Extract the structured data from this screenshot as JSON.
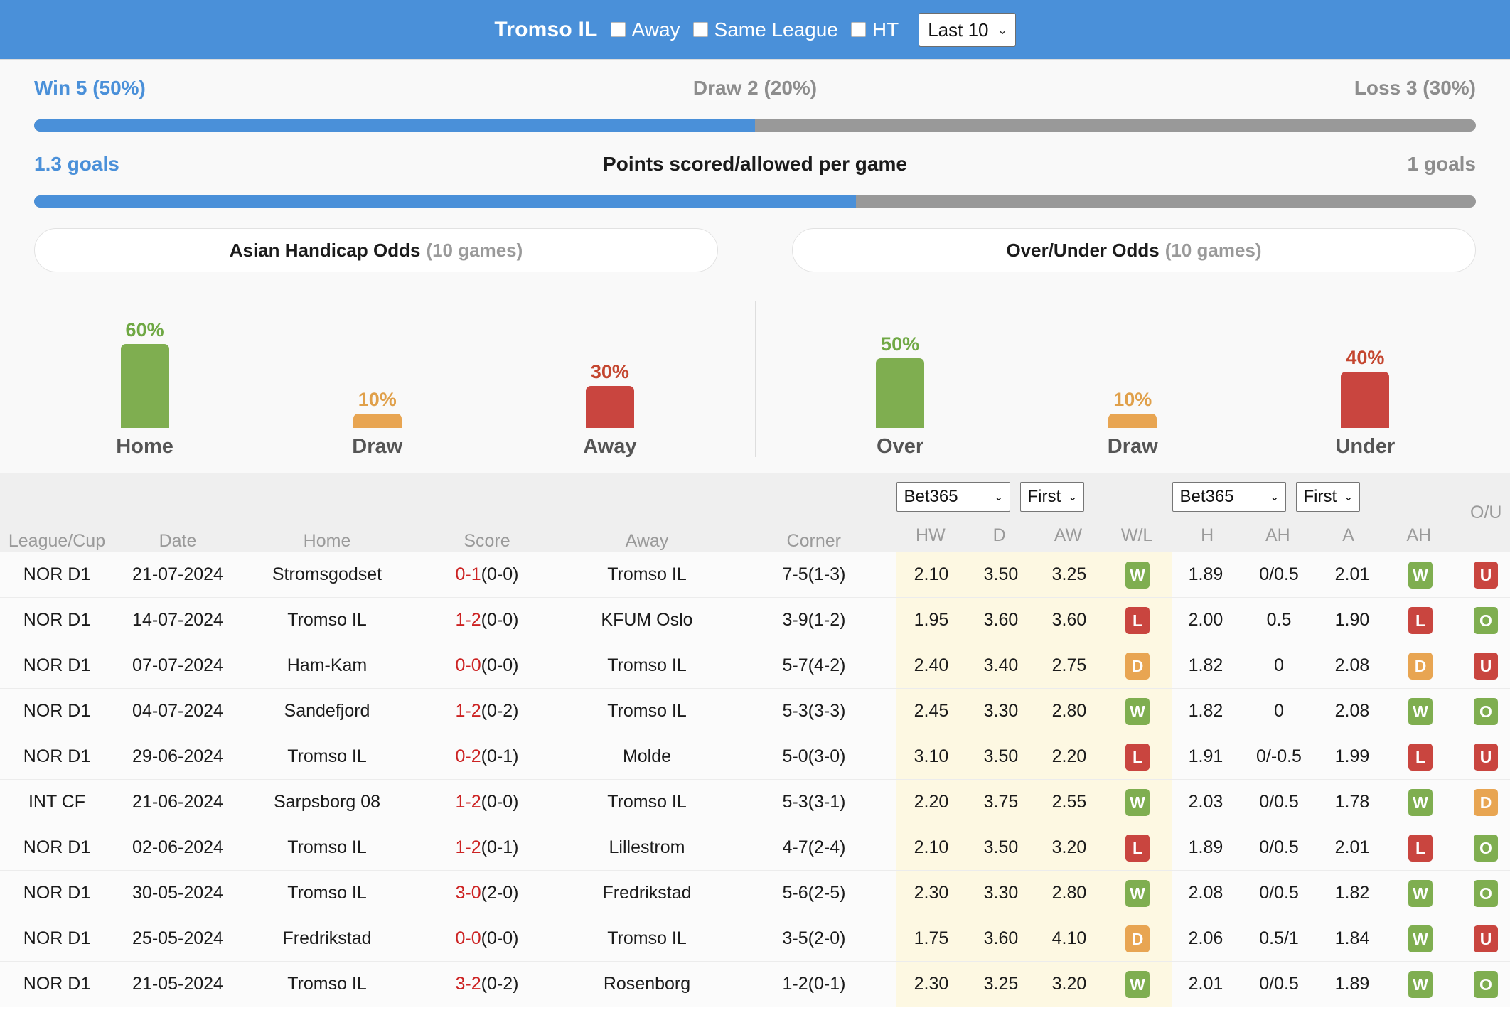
{
  "header": {
    "team": "Tromso IL",
    "filters": [
      {
        "label": "Away",
        "checked": false
      },
      {
        "label": "Same League",
        "checked": false
      },
      {
        "label": "HT",
        "checked": false
      }
    ],
    "range_select": "Last 10",
    "caret": "⌄"
  },
  "summary": {
    "win": "Win 5 (50%)",
    "draw": "Draw 2 (20%)",
    "loss": "Loss 3 (30%)",
    "goals_for": "1.3 goals",
    "points_title": "Points scored/allowed per game",
    "goals_against": "1 goals"
  },
  "pills": {
    "asian": {
      "title": "Asian Handicap Odds",
      "games": "(10 games)"
    },
    "overunder": {
      "title": "Over/Under Odds",
      "games": "(10 games)"
    }
  },
  "colors": {
    "blue": "#4a90d9",
    "grey": "#999999",
    "green": "#7fae50",
    "orange": "#e8a552",
    "red": "#c9453f"
  },
  "chart_data": [
    {
      "type": "bar",
      "title": "Asian Handicap Odds (10 games)",
      "categories": [
        "Home",
        "Draw",
        "Away"
      ],
      "values": [
        60,
        10,
        30
      ],
      "labels": [
        "60%",
        "10%",
        "30%"
      ],
      "colors": [
        "#7fae50",
        "#e8a552",
        "#c9453f"
      ],
      "ylabel": "",
      "xlabel": "",
      "ylim": [
        0,
        100
      ],
      "grid": false,
      "legend": "none"
    },
    {
      "type": "bar",
      "title": "Over/Under Odds (10 games)",
      "categories": [
        "Over",
        "Draw",
        "Under"
      ],
      "values": [
        50,
        10,
        40
      ],
      "labels": [
        "50%",
        "10%",
        "40%"
      ],
      "colors": [
        "#7fae50",
        "#e8a552",
        "#c9453f"
      ],
      "ylabel": "",
      "xlabel": "",
      "ylim": [
        0,
        100
      ],
      "grid": false,
      "legend": "none"
    },
    {
      "type": "bar",
      "title": "Win/Draw/Loss distribution",
      "categories": [
        "Win",
        "Draw",
        "Loss"
      ],
      "values": [
        50,
        20,
        30
      ],
      "labels": [
        "Win 5 (50%)",
        "Draw 2 (20%)",
        "Loss 3 (30%)"
      ],
      "ylabel": "",
      "xlabel": "",
      "ylim": [
        0,
        100
      ],
      "grid": false,
      "legend": "none"
    },
    {
      "type": "bar",
      "title": "Points scored/allowed per game",
      "categories": [
        "Scored",
        "Allowed"
      ],
      "values": [
        1.3,
        1.0
      ],
      "labels": [
        "1.3 goals",
        "1 goals"
      ],
      "ylabel": "",
      "xlabel": "",
      "ylim": [
        0,
        2.3
      ],
      "grid": false,
      "legend": "none"
    }
  ],
  "table": {
    "headers": {
      "league": "League/Cup",
      "date": "Date",
      "home": "Home",
      "score": "Score",
      "away": "Away",
      "corner": "Corner",
      "ou": "O/U"
    },
    "group1": {
      "bookmaker": "Bet365",
      "period": "First",
      "subs": [
        "HW",
        "D",
        "AW",
        "W/L"
      ]
    },
    "group2": {
      "bookmaker": "Bet365",
      "period": "First",
      "subs": [
        "H",
        "AH",
        "A",
        "AH"
      ]
    },
    "rows": [
      {
        "league": "NOR D1",
        "date": "21-07-2024",
        "home": "Stromsgodset",
        "home_link": false,
        "score": "0-1",
        "ht": "(0-0)",
        "away": "Tromso IL",
        "away_link": true,
        "corner": "7-5(1-3)",
        "hw": "2.10",
        "d": "3.50",
        "aw": "3.25",
        "wl": "W",
        "h": "1.89",
        "ah1": "0/0.5",
        "a": "2.01",
        "ah2": "W",
        "ou": "U"
      },
      {
        "league": "NOR D1",
        "date": "14-07-2024",
        "home": "Tromso IL",
        "home_link": true,
        "score": "1-2",
        "ht": "(0-0)",
        "away": "KFUM Oslo",
        "away_link": false,
        "corner": "3-9(1-2)",
        "hw": "1.95",
        "d": "3.60",
        "aw": "3.60",
        "wl": "L",
        "h": "2.00",
        "ah1": "0.5",
        "a": "1.90",
        "ah2": "L",
        "ou": "O"
      },
      {
        "league": "NOR D1",
        "date": "07-07-2024",
        "home": "Ham-Kam",
        "home_link": false,
        "score": "0-0",
        "ht": "(0-0)",
        "away": "Tromso IL",
        "away_link": true,
        "corner": "5-7(4-2)",
        "hw": "2.40",
        "d": "3.40",
        "aw": "2.75",
        "wl": "D",
        "h": "1.82",
        "ah1": "0",
        "a": "2.08",
        "ah2": "D",
        "ou": "U"
      },
      {
        "league": "NOR D1",
        "date": "04-07-2024",
        "home": "Sandefjord",
        "home_link": false,
        "score": "1-2",
        "ht": "(0-2)",
        "away": "Tromso IL",
        "away_link": true,
        "corner": "5-3(3-3)",
        "hw": "2.45",
        "d": "3.30",
        "aw": "2.80",
        "wl": "W",
        "h": "1.82",
        "ah1": "0",
        "a": "2.08",
        "ah2": "W",
        "ou": "O"
      },
      {
        "league": "NOR D1",
        "date": "29-06-2024",
        "home": "Tromso IL",
        "home_link": true,
        "score": "0-2",
        "ht": "(0-1)",
        "away": "Molde",
        "away_link": false,
        "corner": "5-0(3-0)",
        "hw": "3.10",
        "d": "3.50",
        "aw": "2.20",
        "wl": "L",
        "h": "1.91",
        "ah1": "0/-0.5",
        "a": "1.99",
        "ah2": "L",
        "ou": "U"
      },
      {
        "league": "INT CF",
        "date": "21-06-2024",
        "home": "Sarpsborg 08",
        "home_link": false,
        "score": "1-2",
        "ht": "(0-0)",
        "away": "Tromso IL",
        "away_link": true,
        "corner": "5-3(3-1)",
        "hw": "2.20",
        "d": "3.75",
        "aw": "2.55",
        "wl": "W",
        "h": "2.03",
        "ah1": "0/0.5",
        "a": "1.78",
        "ah2": "W",
        "ou": "D"
      },
      {
        "league": "NOR D1",
        "date": "02-06-2024",
        "home": "Tromso IL",
        "home_link": true,
        "score": "1-2",
        "ht": "(0-1)",
        "away": "Lillestrom",
        "away_link": false,
        "corner": "4-7(2-4)",
        "hw": "2.10",
        "d": "3.50",
        "aw": "3.20",
        "wl": "L",
        "h": "1.89",
        "ah1": "0/0.5",
        "a": "2.01",
        "ah2": "L",
        "ou": "O"
      },
      {
        "league": "NOR D1",
        "date": "30-05-2024",
        "home": "Tromso IL",
        "home_link": true,
        "score": "3-0",
        "ht": "(2-0)",
        "away": "Fredrikstad",
        "away_link": false,
        "corner": "5-6(2-5)",
        "hw": "2.30",
        "d": "3.30",
        "aw": "2.80",
        "wl": "W",
        "h": "2.08",
        "ah1": "0/0.5",
        "a": "1.82",
        "ah2": "W",
        "ou": "O"
      },
      {
        "league": "NOR D1",
        "date": "25-05-2024",
        "home": "Fredrikstad",
        "home_link": false,
        "score": "0-0",
        "ht": "(0-0)",
        "away": "Tromso IL",
        "away_link": true,
        "corner": "3-5(2-0)",
        "hw": "1.75",
        "d": "3.60",
        "aw": "4.10",
        "wl": "D",
        "h": "2.06",
        "ah1": "0.5/1",
        "a": "1.84",
        "ah2": "W",
        "ou": "U"
      },
      {
        "league": "NOR D1",
        "date": "21-05-2024",
        "home": "Tromso IL",
        "home_link": true,
        "score": "3-2",
        "ht": "(0-2)",
        "away": "Rosenborg",
        "away_link": false,
        "corner": "1-2(0-1)",
        "hw": "2.30",
        "d": "3.25",
        "aw": "3.20",
        "wl": "W",
        "h": "2.01",
        "ah1": "0/0.5",
        "a": "1.89",
        "ah2": "W",
        "ou": "O"
      }
    ]
  }
}
